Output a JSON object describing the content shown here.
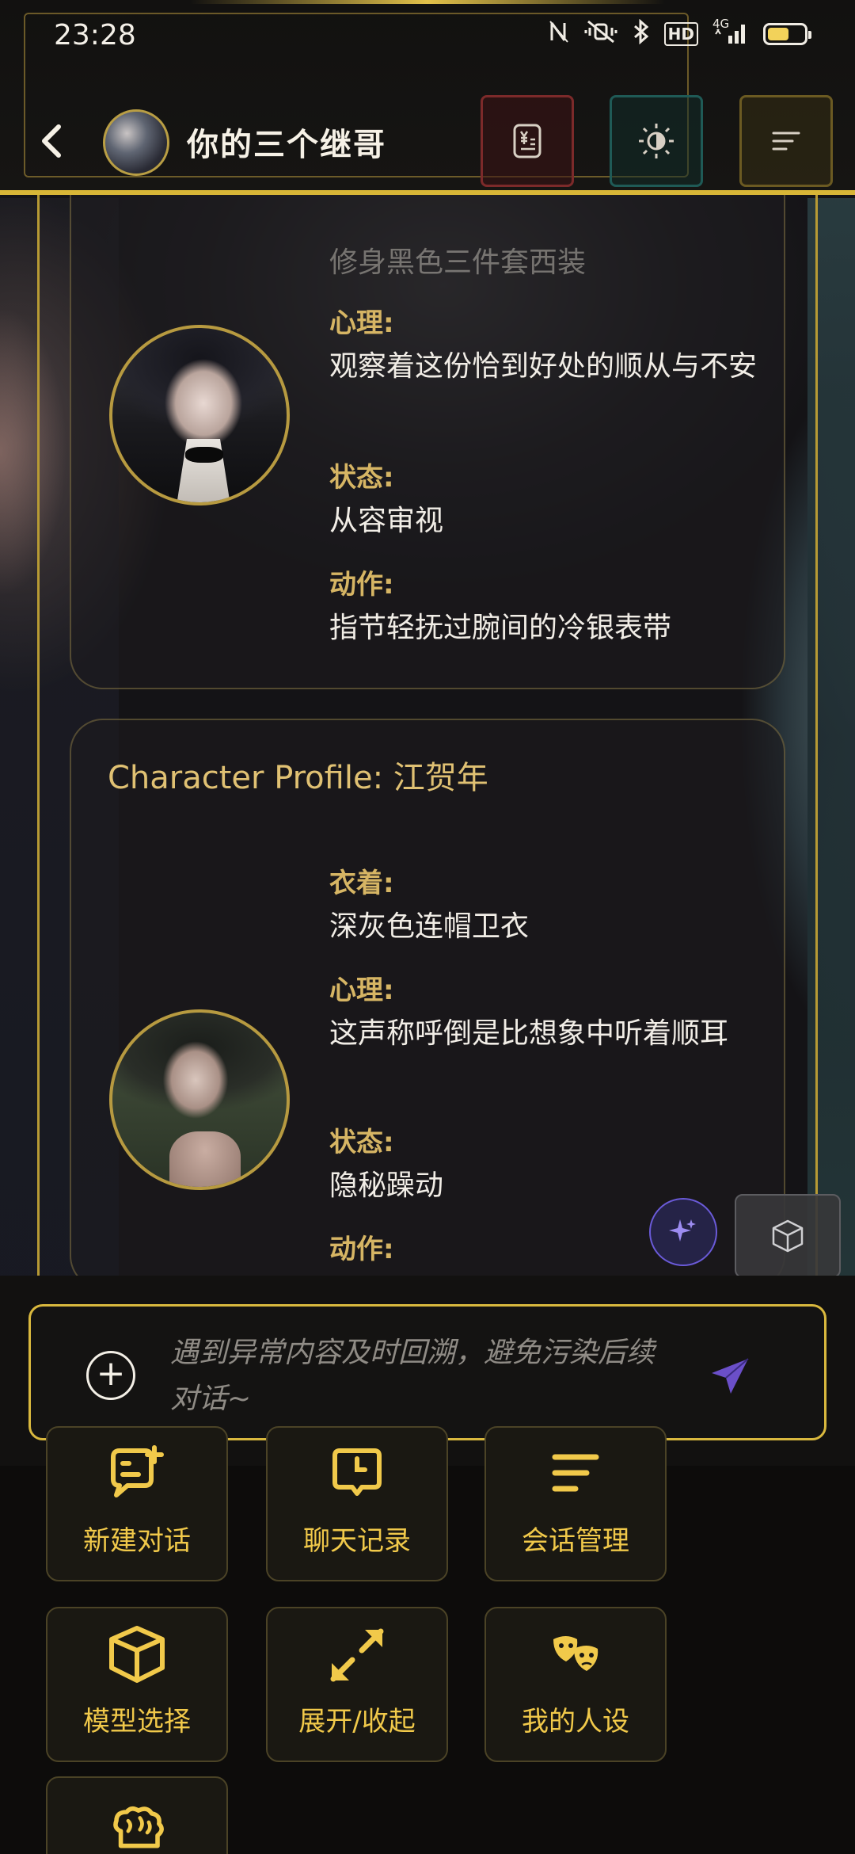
{
  "status_bar": {
    "time": "23:28",
    "network": "4G",
    "hd": "HD"
  },
  "header": {
    "title": "你的三个继哥"
  },
  "card1": {
    "faded_line": "修身黑色三件套西装",
    "fields": [
      {
        "label": "心理:",
        "value": "观察着这份恰到好处的顺从与不安"
      },
      {
        "label": "状态:",
        "value": "从容审视"
      },
      {
        "label": "动作:",
        "value": "指节轻抚过腕间的冷银表带"
      }
    ]
  },
  "card2": {
    "title": "Character Profile: 江贺年",
    "fields": [
      {
        "label": "衣着:",
        "value": "深灰色连帽卫衣"
      },
      {
        "label": "心理:",
        "value": "这声称呼倒是比想象中听着顺耳"
      },
      {
        "label": "状态:",
        "value": "隐秘躁动"
      },
      {
        "label": "动作:",
        "value": ""
      }
    ]
  },
  "input": {
    "placeholder": "遇到异常内容及时回溯，避免污染后续对话~"
  },
  "tools": [
    {
      "label": "新建对话",
      "icon": "new-chat-icon"
    },
    {
      "label": "聊天记录",
      "icon": "history-icon"
    },
    {
      "label": "会话管理",
      "icon": "manage-icon"
    },
    {
      "label": "模型选择",
      "icon": "cube-icon"
    },
    {
      "label": "展开/收起",
      "icon": "expand-icon"
    },
    {
      "label": "我的人设",
      "icon": "masks-icon"
    },
    {
      "label": "",
      "icon": "brain-icon"
    }
  ],
  "colors": {
    "gold": "#d8b637",
    "label_gold": "#d6b564",
    "tool_gold": "#f1c94a",
    "send_purple": "#6b4fc9"
  }
}
